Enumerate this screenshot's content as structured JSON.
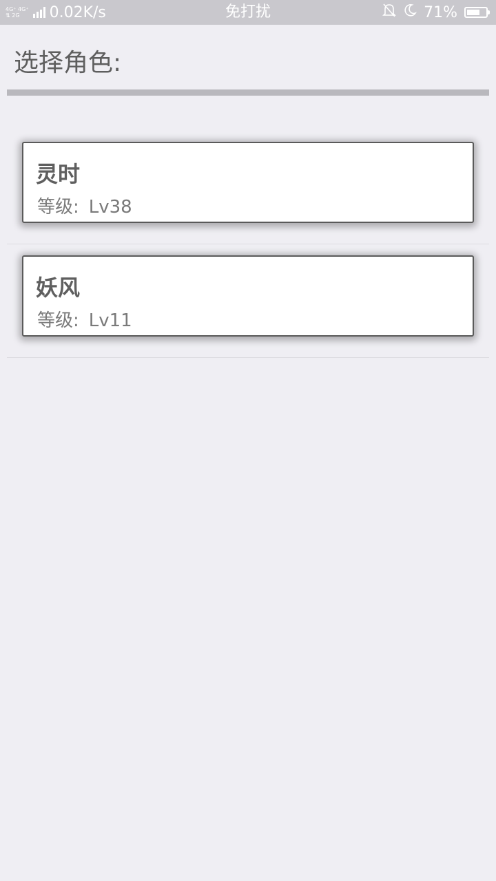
{
  "status_bar": {
    "net_top": "4G⁺ 4G⁺",
    "net_bottom": "⇅ 2G",
    "speed": "0.02K/s",
    "mode": "免打扰",
    "battery": "71%",
    "battery_level": 0.71
  },
  "header": {
    "title": "选择角色:"
  },
  "characters": [
    {
      "name": "灵时",
      "level_label": "等级:",
      "level": "Lv38"
    },
    {
      "name": "妖风",
      "level_label": "等级:",
      "level": "Lv11"
    }
  ]
}
